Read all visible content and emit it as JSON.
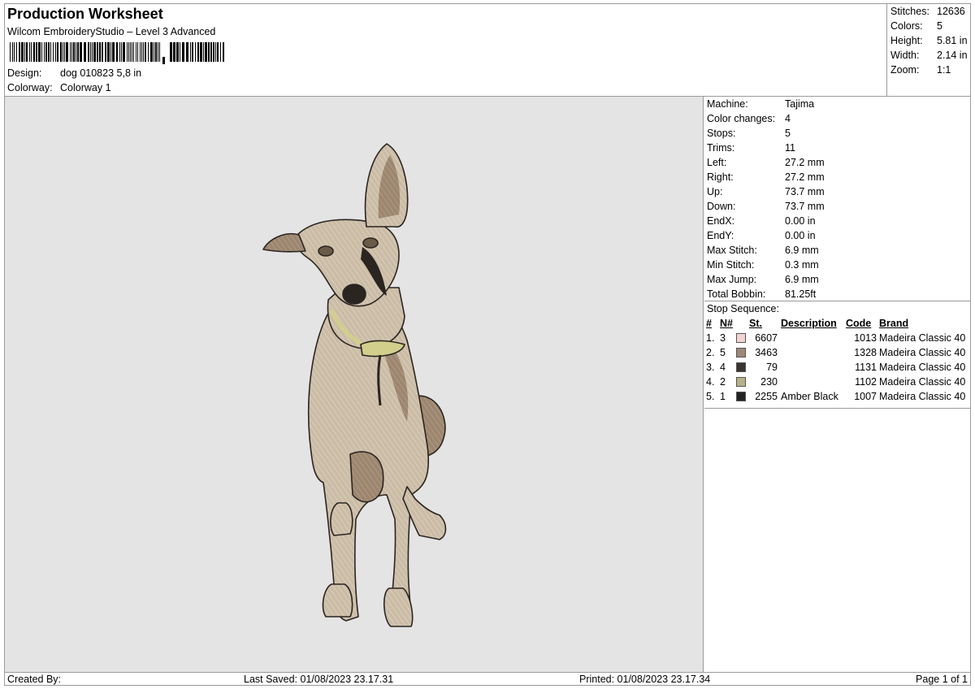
{
  "header": {
    "title": "Production Worksheet",
    "software": "Wilcom EmbroideryStudio – Level 3 Advanced",
    "design_label": "Design:",
    "design_value": "dog 010823 5,8 in",
    "colorway_label": "Colorway:",
    "colorway_value": "Colorway 1"
  },
  "stats": [
    {
      "label": "Stitches:",
      "value": "12636"
    },
    {
      "label": "Colors:",
      "value": "5"
    },
    {
      "label": "Height:",
      "value": "5.81 in"
    },
    {
      "label": "Width:",
      "value": "2.14 in"
    },
    {
      "label": "Zoom:",
      "value": "1:1"
    }
  ],
  "machine_info": [
    {
      "label": "Machine:",
      "value": "Tajima"
    },
    {
      "label": "Color changes:",
      "value": "4"
    },
    {
      "label": "Stops:",
      "value": "5"
    },
    {
      "label": "Trims:",
      "value": "11"
    },
    {
      "label": "Left:",
      "value": "27.2 mm"
    },
    {
      "label": "Right:",
      "value": "27.2 mm"
    },
    {
      "label": "Up:",
      "value": "73.7 mm"
    },
    {
      "label": "Down:",
      "value": "73.7 mm"
    },
    {
      "label": "EndX:",
      "value": "0.00 in"
    },
    {
      "label": "EndY:",
      "value": "0.00 in"
    },
    {
      "label": "Max Stitch:",
      "value": "6.9 mm"
    },
    {
      "label": "Min Stitch:",
      "value": "0.3 mm"
    },
    {
      "label": "Max Jump:",
      "value": "6.9 mm"
    },
    {
      "label": "Total Bobbin:",
      "value": "81.25ft"
    }
  ],
  "stop_sequence": {
    "caption": "Stop Sequence:",
    "headers": {
      "num": "#",
      "n": "N#",
      "st": "St.",
      "desc": "Description",
      "code": "Code",
      "brand": "Brand"
    },
    "rows": [
      {
        "num": "1.",
        "n": "3",
        "color": "#f2d4d2",
        "st": "6607",
        "desc": "",
        "code": "1013",
        "brand": "Madeira Classic 40"
      },
      {
        "num": "2.",
        "n": "5",
        "color": "#a08878",
        "st": "3463",
        "desc": "",
        "code": "1328",
        "brand": "Madeira Classic 40"
      },
      {
        "num": "3.",
        "n": "4",
        "color": "#3c3430",
        "st": "79",
        "desc": "",
        "code": "1131",
        "brand": "Madeira Classic 40"
      },
      {
        "num": "4.",
        "n": "2",
        "color": "#b8b088",
        "st": "230",
        "desc": "",
        "code": "1102",
        "brand": "Madeira Classic 40"
      },
      {
        "num": "5.",
        "n": "1",
        "color": "#222222",
        "st": "2255",
        "desc": "Amber Black",
        "code": "1007",
        "brand": "Madeira Classic 40"
      }
    ]
  },
  "colors": {
    "fur_light": "#c9b9a3",
    "fur_dark": "#9c8670",
    "outline": "#2a2520",
    "collar": "#d2cf8c",
    "canvas": "#e4e4e4"
  },
  "footer": {
    "created_by": "Created By:",
    "last_saved": "Last Saved: 01/08/2023 23.17.31",
    "printed": "Printed: 01/08/2023 23.17.34",
    "page": "Page 1 of 1"
  }
}
